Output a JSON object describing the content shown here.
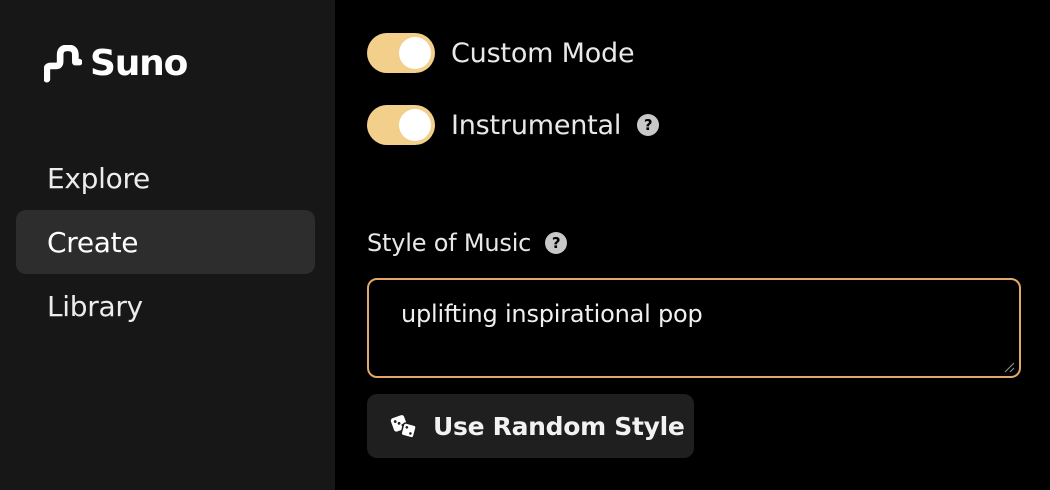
{
  "brand": {
    "name": "Suno",
    "logo_icon": "suno-wave-icon"
  },
  "sidebar": {
    "items": [
      {
        "label": "Explore",
        "active": false
      },
      {
        "label": "Create",
        "active": true
      },
      {
        "label": "Library",
        "active": false
      }
    ]
  },
  "create_form": {
    "custom_mode": {
      "label": "Custom Mode",
      "enabled": true
    },
    "instrumental": {
      "label": "Instrumental",
      "enabled": true,
      "help_icon": "question-circle-icon"
    },
    "style_of_music": {
      "label": "Style of Music",
      "help_icon": "question-circle-icon",
      "value": "uplifting inspirational pop"
    },
    "random_style_button": {
      "label": "Use Random Style",
      "icon": "dice-icon"
    }
  },
  "colors": {
    "toggle_on": "#f3cf8c",
    "input_border": "#e3a66b",
    "sidebar_bg": "#171717",
    "active_item_bg": "#2d2d2d",
    "main_bg": "#000000"
  }
}
